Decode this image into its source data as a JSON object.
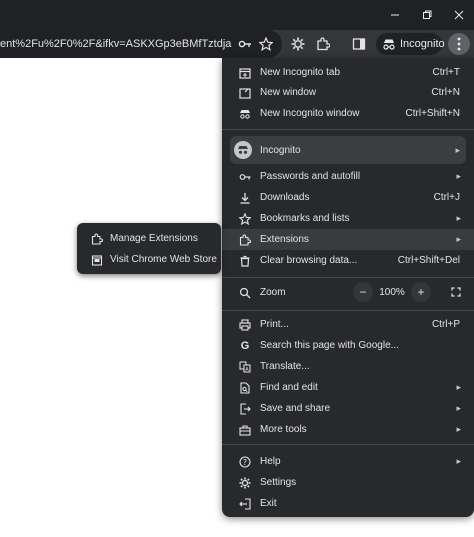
{
  "window": {
    "minimize_icon": "minimize-icon",
    "maximize_icon": "restore-icon",
    "close_icon": "close-icon"
  },
  "toolbar": {
    "url": "ent%2Fu%2F0%2F&ifkv=ASKXGp3eBMfTztdjaDbBE...",
    "profile_label": "Incognito"
  },
  "menu": {
    "new_tab": {
      "label": "New Incognito tab",
      "shortcut": "Ctrl+T"
    },
    "new_window": {
      "label": "New window",
      "shortcut": "Ctrl+N"
    },
    "new_incognito_window": {
      "label": "New Incognito window",
      "shortcut": "Ctrl+Shift+N"
    },
    "incognito": {
      "label": "Incognito"
    },
    "passwords": {
      "label": "Passwords and autofill"
    },
    "downloads": {
      "label": "Downloads",
      "shortcut": "Ctrl+J"
    },
    "bookmarks": {
      "label": "Bookmarks and lists"
    },
    "extensions": {
      "label": "Extensions"
    },
    "clear_data": {
      "label": "Clear browsing data...",
      "shortcut": "Ctrl+Shift+Del"
    },
    "zoom": {
      "label": "Zoom",
      "minus": "−",
      "value": "100%",
      "plus": "+"
    },
    "print": {
      "label": "Print...",
      "shortcut": "Ctrl+P"
    },
    "search_google": {
      "label": "Search this page with Google..."
    },
    "translate": {
      "label": "Translate..."
    },
    "find_edit": {
      "label": "Find and edit"
    },
    "save_share": {
      "label": "Save and share"
    },
    "more_tools": {
      "label": "More tools"
    },
    "help": {
      "label": "Help"
    },
    "settings": {
      "label": "Settings"
    },
    "exit": {
      "label": "Exit"
    }
  },
  "submenu": {
    "manage_extensions": "Manage Extensions",
    "visit_store": "Visit Chrome Web Store"
  }
}
